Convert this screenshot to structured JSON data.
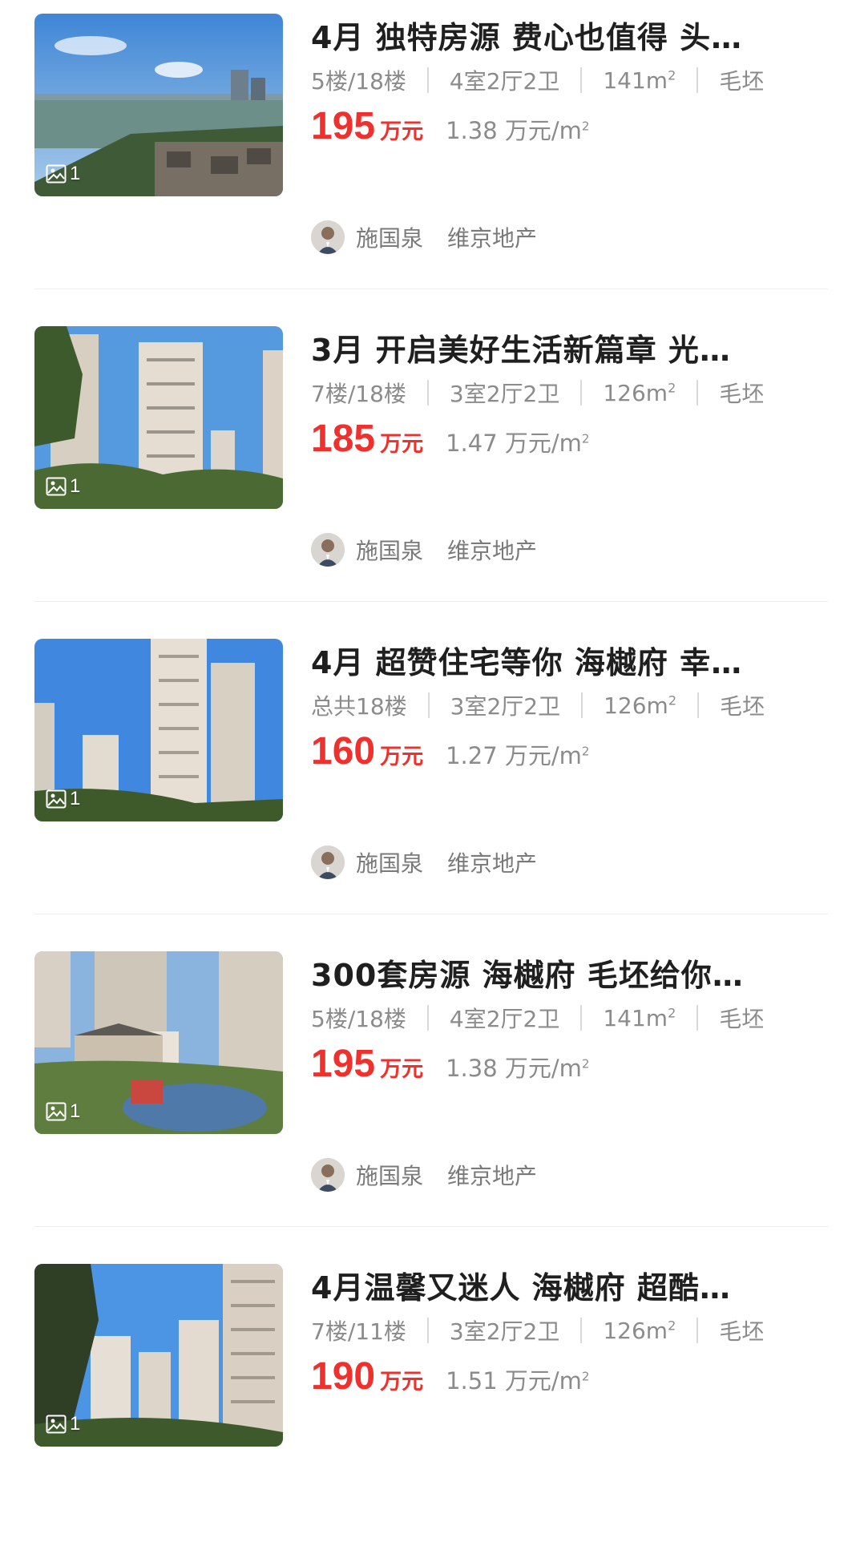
{
  "listings": [
    {
      "title": "4月 独特房源 费心也值得 头…",
      "floor": "5楼/18楼",
      "layout": "4室2厅2卫",
      "area": "141m",
      "area_sup": "2",
      "decor": "毛坯",
      "price": "195",
      "price_unit": "万元",
      "unit_price": "1.38 万元/m",
      "unit_sup": "2",
      "photo_count": "1",
      "agent": "施国泉",
      "agency": "维京地产"
    },
    {
      "title": "3月 开启美好生活新篇章 光…",
      "floor": "7楼/18楼",
      "layout": "3室2厅2卫",
      "area": "126m",
      "area_sup": "2",
      "decor": "毛坯",
      "price": "185",
      "price_unit": "万元",
      "unit_price": "1.47 万元/m",
      "unit_sup": "2",
      "photo_count": "1",
      "agent": "施国泉",
      "agency": "维京地产"
    },
    {
      "title": "4月 超赞住宅等你 海樾府 幸…",
      "floor": "总共18楼",
      "layout": "3室2厅2卫",
      "area": "126m",
      "area_sup": "2",
      "decor": "毛坯",
      "price": "160",
      "price_unit": "万元",
      "unit_price": "1.27 万元/m",
      "unit_sup": "2",
      "photo_count": "1",
      "agent": "施国泉",
      "agency": "维京地产"
    },
    {
      "title": "300套房源 海樾府 毛坯给你…",
      "floor": "5楼/18楼",
      "layout": "4室2厅2卫",
      "area": "141m",
      "area_sup": "2",
      "decor": "毛坯",
      "price": "195",
      "price_unit": "万元",
      "unit_price": "1.38 万元/m",
      "unit_sup": "2",
      "photo_count": "1",
      "agent": "施国泉",
      "agency": "维京地产"
    },
    {
      "title": "4月温馨又迷人 海樾府 超酷…",
      "floor": "7楼/11楼",
      "layout": "3室2厅2卫",
      "area": "126m",
      "area_sup": "2",
      "decor": "毛坯",
      "price": "190",
      "price_unit": "万元",
      "unit_price": "1.51 万元/m",
      "unit_sup": "2",
      "photo_count": "1",
      "agent": null,
      "agency": null
    }
  ],
  "colors": {
    "price": "#f0302d",
    "meta": "#8b8b8b",
    "title": "#1f1f1f"
  },
  "icons": {
    "photo_badge": "image-icon",
    "avatar": "agent-avatar"
  }
}
